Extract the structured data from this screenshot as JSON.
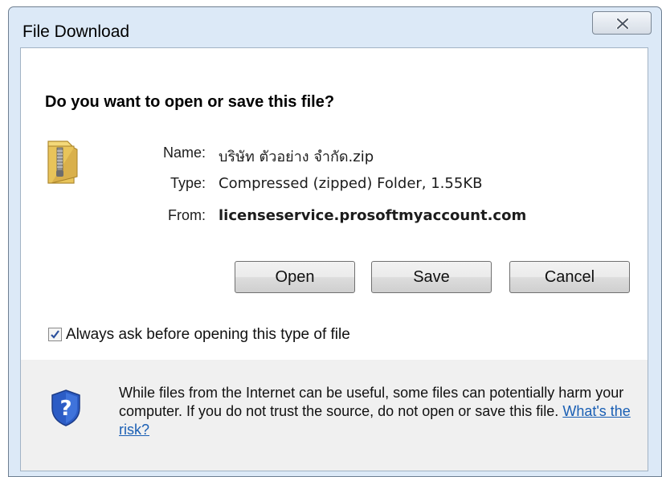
{
  "window": {
    "title": "File Download"
  },
  "dialog": {
    "question": "Do you want to open or save this file?",
    "fields": {
      "name_label": "Name:",
      "name_value": "บริษัท ตัวอย่าง จำกัด.zip",
      "type_label": "Type:",
      "type_value": "Compressed (zipped) Folder, 1.55KB",
      "from_label": "From:",
      "from_value": "licenseservice.prosoftmyaccount.com"
    },
    "buttons": {
      "open": "Open",
      "save": "Save",
      "cancel": "Cancel"
    },
    "checkbox": {
      "label": "Always ask before opening this type of file",
      "checked": true
    },
    "warning": {
      "text": "While files from the Internet can be useful, some files can potentially harm your computer. If you do not trust the source, do not open or save this file.",
      "link": "What's the risk?"
    }
  },
  "icons": {
    "close": "close-icon",
    "folder": "zip-folder-icon",
    "shield": "shield-question-icon",
    "check": "checkmark-icon"
  },
  "colors": {
    "frame": "#dce9f7",
    "link": "#1a5fb4",
    "shield": "#2c5cc5",
    "folder": "#e8c45a"
  }
}
